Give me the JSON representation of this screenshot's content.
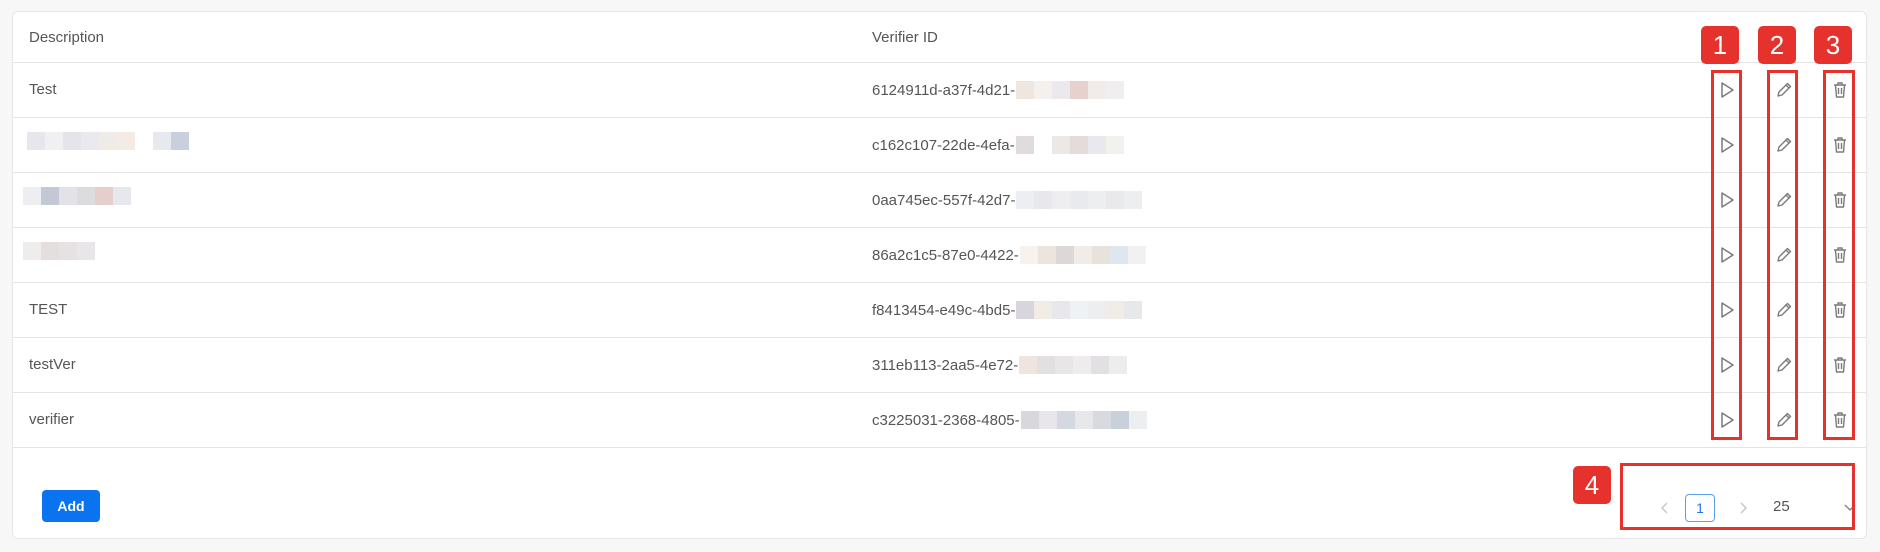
{
  "table": {
    "columns": {
      "description": "Description",
      "verifier_id": "Verifier ID"
    },
    "rows": [
      {
        "description": "Test",
        "verifier_id": "6124911d-a37f-4d21-"
      },
      {
        "description": "",
        "verifier_id": "c162c107-22de-4efa-"
      },
      {
        "description": "",
        "verifier_id": "0aa745ec-557f-42d7-"
      },
      {
        "description": "",
        "verifier_id": "86a2c1c5-87e0-4422-"
      },
      {
        "description": "TEST",
        "verifier_id": "f8413454-e49c-4bd5-"
      },
      {
        "description": "testVer",
        "verifier_id": "311eb113-2aa5-4e72-"
      },
      {
        "description": "verifier",
        "verifier_id": "c3225031-2368-4805-"
      }
    ],
    "icons": {
      "run": "play-icon",
      "edit": "pencil-icon",
      "delete": "trash-icon"
    }
  },
  "footer": {
    "add_label": "Add",
    "pagination": {
      "current_page": "1",
      "page_size": "25"
    }
  },
  "annotations": [
    "1",
    "2",
    "3",
    "4"
  ],
  "colors": {
    "accent": "#0a74f0",
    "annotation": "#e5322d",
    "text": "#555555",
    "border": "#e4e4e7"
  }
}
